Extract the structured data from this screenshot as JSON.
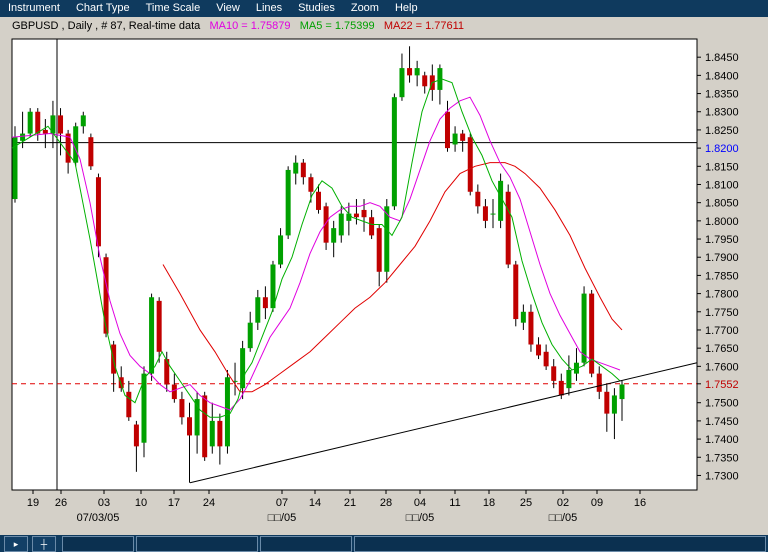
{
  "menu": [
    "Instrument",
    "Chart Type",
    "Time Scale",
    "View",
    "Lines",
    "Studies",
    "Zoom",
    "Help"
  ],
  "title": {
    "symbol": "GBPUSD , Daily , # 87, Real-time data",
    "ma10": "MA10 = 1.75879",
    "ma5": "MA5 = 1.75399",
    "ma22": "MA22 = 1.77611"
  },
  "colors": {
    "up": "#00a000",
    "down": "#c00000",
    "ma10": "#e000e0",
    "ma5": "#00b000",
    "ma22": "#e00000",
    "menu_bg": "#0f3a5e"
  },
  "status_icons": [
    "cursor-icon",
    "crosshair-icon"
  ],
  "chart_data": {
    "type": "candlestick",
    "y_ticks": [
      "1.8450",
      "1.8400",
      "1.8350",
      "1.8300",
      "1.8250",
      "1.8200",
      "1.8150",
      "1.8100",
      "1.8050",
      "1.8000",
      "1.7950",
      "1.7900",
      "1.7850",
      "1.7800",
      "1.7750",
      "1.7700",
      "1.7650",
      "1.7600",
      "1.7552",
      "1.7500",
      "1.7450",
      "1.7400",
      "1.7350",
      "1.7300"
    ],
    "highlight_ticks": {
      "1.8200": "#0000ff",
      "1.7552": "#c00000"
    },
    "ylim": [
      1.726,
      1.85
    ],
    "x_ticks": [
      "19",
      "26",
      "03",
      "10",
      "17",
      "24",
      "07",
      "14",
      "21",
      "28",
      "04",
      "11",
      "18",
      "25",
      "02",
      "09",
      "16"
    ],
    "x_date_labels": [
      "07/03/05",
      "□□/05",
      "□□/05",
      "□□/05"
    ],
    "horizontal_level": 1.8215,
    "current_price": 1.7552,
    "candles": [
      {
        "o": 1.806,
        "c": 1.823,
        "h": 1.826,
        "l": 1.805
      },
      {
        "o": 1.822,
        "c": 1.824,
        "h": 1.83,
        "l": 1.82
      },
      {
        "o": 1.824,
        "c": 1.83,
        "h": 1.831,
        "l": 1.823
      },
      {
        "o": 1.83,
        "c": 1.824,
        "h": 1.831,
        "l": 1.822
      },
      {
        "o": 1.825,
        "c": 1.824,
        "h": 1.828,
        "l": 1.82
      },
      {
        "o": 1.824,
        "c": 1.829,
        "h": 1.833,
        "l": 1.82
      },
      {
        "o": 1.829,
        "c": 1.824,
        "h": 1.831,
        "l": 1.818
      },
      {
        "o": 1.824,
        "c": 1.816,
        "h": 1.825,
        "l": 1.813
      },
      {
        "o": 1.816,
        "c": 1.826,
        "h": 1.827,
        "l": 1.815
      },
      {
        "o": 1.826,
        "c": 1.829,
        "h": 1.83,
        "l": 1.824
      },
      {
        "o": 1.823,
        "c": 1.815,
        "h": 1.824,
        "l": 1.814
      },
      {
        "o": 1.812,
        "c": 1.793,
        "h": 1.813,
        "l": 1.79
      },
      {
        "o": 1.79,
        "c": 1.769,
        "h": 1.791,
        "l": 1.768
      },
      {
        "o": 1.766,
        "c": 1.758,
        "h": 1.767,
        "l": 1.753
      },
      {
        "o": 1.757,
        "c": 1.754,
        "h": 1.76,
        "l": 1.753
      },
      {
        "o": 1.753,
        "c": 1.746,
        "h": 1.756,
        "l": 1.745
      },
      {
        "o": 1.744,
        "c": 1.738,
        "h": 1.745,
        "l": 1.731
      },
      {
        "o": 1.739,
        "c": 1.758,
        "h": 1.76,
        "l": 1.735
      },
      {
        "o": 1.758,
        "c": 1.779,
        "h": 1.78,
        "l": 1.756
      },
      {
        "o": 1.778,
        "c": 1.764,
        "h": 1.779,
        "l": 1.761
      },
      {
        "o": 1.762,
        "c": 1.755,
        "h": 1.764,
        "l": 1.753
      },
      {
        "o": 1.755,
        "c": 1.751,
        "h": 1.758,
        "l": 1.75
      },
      {
        "o": 1.751,
        "c": 1.746,
        "h": 1.753,
        "l": 1.744
      },
      {
        "o": 1.746,
        "c": 1.741,
        "h": 1.75,
        "l": 1.728
      },
      {
        "o": 1.741,
        "c": 1.751,
        "h": 1.753,
        "l": 1.736
      },
      {
        "o": 1.752,
        "c": 1.735,
        "h": 1.753,
        "l": 1.734
      },
      {
        "o": 1.738,
        "c": 1.745,
        "h": 1.75,
        "l": 1.736
      },
      {
        "o": 1.745,
        "c": 1.738,
        "h": 1.747,
        "l": 1.733
      },
      {
        "o": 1.738,
        "c": 1.757,
        "h": 1.759,
        "l": 1.736
      },
      {
        "o": 1.756,
        "c": 1.756,
        "h": 1.761,
        "l": 1.752
      },
      {
        "o": 1.754,
        "c": 1.765,
        "h": 1.767,
        "l": 1.751
      },
      {
        "o": 1.765,
        "c": 1.772,
        "h": 1.775,
        "l": 1.764
      },
      {
        "o": 1.772,
        "c": 1.779,
        "h": 1.781,
        "l": 1.77
      },
      {
        "o": 1.779,
        "c": 1.776,
        "h": 1.782,
        "l": 1.773
      },
      {
        "o": 1.776,
        "c": 1.788,
        "h": 1.789,
        "l": 1.775
      },
      {
        "o": 1.788,
        "c": 1.796,
        "h": 1.798,
        "l": 1.787
      },
      {
        "o": 1.796,
        "c": 1.814,
        "h": 1.815,
        "l": 1.795
      },
      {
        "o": 1.813,
        "c": 1.816,
        "h": 1.818,
        "l": 1.81
      },
      {
        "o": 1.816,
        "c": 1.812,
        "h": 1.817,
        "l": 1.81
      },
      {
        "o": 1.812,
        "c": 1.808,
        "h": 1.813,
        "l": 1.805
      },
      {
        "o": 1.808,
        "c": 1.803,
        "h": 1.81,
        "l": 1.802
      },
      {
        "o": 1.804,
        "c": 1.794,
        "h": 1.805,
        "l": 1.792
      },
      {
        "o": 1.794,
        "c": 1.798,
        "h": 1.8,
        "l": 1.79
      },
      {
        "o": 1.796,
        "c": 1.802,
        "h": 1.804,
        "l": 1.794
      },
      {
        "o": 1.8,
        "c": 1.802,
        "h": 1.805,
        "l": 1.796
      },
      {
        "o": 1.802,
        "c": 1.801,
        "h": 1.806,
        "l": 1.799
      },
      {
        "o": 1.803,
        "c": 1.801,
        "h": 1.806,
        "l": 1.797
      },
      {
        "o": 1.801,
        "c": 1.796,
        "h": 1.803,
        "l": 1.795
      },
      {
        "o": 1.798,
        "c": 1.786,
        "h": 1.799,
        "l": 1.782
      },
      {
        "o": 1.786,
        "c": 1.804,
        "h": 1.806,
        "l": 1.783
      },
      {
        "o": 1.804,
        "c": 1.834,
        "h": 1.835,
        "l": 1.803
      },
      {
        "o": 1.834,
        "c": 1.842,
        "h": 1.846,
        "l": 1.833
      },
      {
        "o": 1.842,
        "c": 1.84,
        "h": 1.848,
        "l": 1.838
      },
      {
        "o": 1.84,
        "c": 1.842,
        "h": 1.844,
        "l": 1.837
      },
      {
        "o": 1.84,
        "c": 1.837,
        "h": 1.841,
        "l": 1.835
      },
      {
        "o": 1.84,
        "c": 1.836,
        "h": 1.843,
        "l": 1.833
      },
      {
        "o": 1.836,
        "c": 1.842,
        "h": 1.843,
        "l": 1.832
      },
      {
        "o": 1.83,
        "c": 1.82,
        "h": 1.833,
        "l": 1.819
      },
      {
        "o": 1.821,
        "c": 1.824,
        "h": 1.826,
        "l": 1.819
      },
      {
        "o": 1.824,
        "c": 1.822,
        "h": 1.825,
        "l": 1.819
      },
      {
        "o": 1.823,
        "c": 1.808,
        "h": 1.824,
        "l": 1.807
      },
      {
        "o": 1.808,
        "c": 1.804,
        "h": 1.81,
        "l": 1.802
      },
      {
        "o": 1.804,
        "c": 1.8,
        "h": 1.806,
        "l": 1.798
      },
      {
        "o": 1.802,
        "c": 1.802,
        "h": 1.806,
        "l": 1.798
      },
      {
        "o": 1.8,
        "c": 1.811,
        "h": 1.813,
        "l": 1.798
      },
      {
        "o": 1.808,
        "c": 1.788,
        "h": 1.81,
        "l": 1.787
      },
      {
        "o": 1.788,
        "c": 1.773,
        "h": 1.789,
        "l": 1.771
      },
      {
        "o": 1.772,
        "c": 1.775,
        "h": 1.777,
        "l": 1.77
      },
      {
        "o": 1.775,
        "c": 1.766,
        "h": 1.777,
        "l": 1.764
      },
      {
        "o": 1.766,
        "c": 1.763,
        "h": 1.768,
        "l": 1.762
      },
      {
        "o": 1.764,
        "c": 1.76,
        "h": 1.766,
        "l": 1.759
      },
      {
        "o": 1.76,
        "c": 1.756,
        "h": 1.762,
        "l": 1.754
      },
      {
        "o": 1.756,
        "c": 1.752,
        "h": 1.758,
        "l": 1.751
      },
      {
        "o": 1.754,
        "c": 1.759,
        "h": 1.763,
        "l": 1.752
      },
      {
        "o": 1.758,
        "c": 1.761,
        "h": 1.765,
        "l": 1.756
      },
      {
        "o": 1.761,
        "c": 1.78,
        "h": 1.782,
        "l": 1.76
      },
      {
        "o": 1.78,
        "c": 1.758,
        "h": 1.781,
        "l": 1.757
      },
      {
        "o": 1.758,
        "c": 1.753,
        "h": 1.76,
        "l": 1.751
      },
      {
        "o": 1.753,
        "c": 1.747,
        "h": 1.755,
        "l": 1.742
      },
      {
        "o": 1.747,
        "c": 1.752,
        "h": 1.754,
        "l": 1.74
      },
      {
        "o": 1.751,
        "c": 1.755,
        "h": 1.756,
        "l": 1.745
      }
    ],
    "ma5_points": [
      [
        12,
        1.82
      ],
      [
        48,
        1.826
      ],
      [
        75,
        1.816
      ],
      [
        90,
        1.795
      ],
      [
        105,
        1.772
      ],
      [
        115,
        1.76
      ],
      [
        125,
        1.752
      ],
      [
        135,
        1.75
      ],
      [
        145,
        1.757
      ],
      [
        155,
        1.76
      ],
      [
        162,
        1.764
      ],
      [
        170,
        1.76
      ],
      [
        180,
        1.756
      ],
      [
        190,
        1.752
      ],
      [
        200,
        1.748
      ],
      [
        210,
        1.746
      ],
      [
        220,
        1.746
      ],
      [
        230,
        1.747
      ],
      [
        238,
        1.751
      ],
      [
        245,
        1.758
      ],
      [
        252,
        1.761
      ],
      [
        262,
        1.768
      ],
      [
        272,
        1.775
      ],
      [
        282,
        1.784
      ],
      [
        292,
        1.79
      ],
      [
        302,
        1.799
      ],
      [
        312,
        1.807
      ],
      [
        322,
        1.811
      ],
      [
        332,
        1.809
      ],
      [
        342,
        1.804
      ],
      [
        352,
        1.801
      ],
      [
        362,
        1.8
      ],
      [
        372,
        1.799
      ],
      [
        382,
        1.799
      ],
      [
        392,
        1.796
      ],
      [
        402,
        1.801
      ],
      [
        412,
        1.816
      ],
      [
        422,
        1.83
      ],
      [
        432,
        1.838
      ],
      [
        442,
        1.839
      ],
      [
        452,
        1.838
      ],
      [
        462,
        1.83
      ],
      [
        472,
        1.823
      ],
      [
        482,
        1.818
      ],
      [
        492,
        1.811
      ],
      [
        502,
        1.806
      ],
      [
        512,
        1.801
      ],
      [
        522,
        1.789
      ],
      [
        532,
        1.78
      ],
      [
        542,
        1.772
      ],
      [
        552,
        1.766
      ],
      [
        562,
        1.762
      ],
      [
        572,
        1.759
      ],
      [
        582,
        1.76
      ],
      [
        592,
        1.762
      ],
      [
        602,
        1.76
      ],
      [
        612,
        1.758
      ],
      [
        620,
        1.756
      ]
    ],
    "ma10_points": [
      [
        12,
        1.823
      ],
      [
        50,
        1.824
      ],
      [
        70,
        1.823
      ],
      [
        80,
        1.817
      ],
      [
        90,
        1.805
      ],
      [
        100,
        1.79
      ],
      [
        110,
        1.778
      ],
      [
        120,
        1.769
      ],
      [
        130,
        1.763
      ],
      [
        140,
        1.76
      ],
      [
        150,
        1.758
      ],
      [
        160,
        1.755
      ],
      [
        170,
        1.753
      ],
      [
        180,
        1.754
      ],
      [
        190,
        1.755
      ],
      [
        200,
        1.752
      ],
      [
        210,
        1.75
      ],
      [
        220,
        1.749
      ],
      [
        230,
        1.748
      ],
      [
        240,
        1.751
      ],
      [
        250,
        1.756
      ],
      [
        260,
        1.762
      ],
      [
        270,
        1.768
      ],
      [
        280,
        1.772
      ],
      [
        290,
        1.776
      ],
      [
        300,
        1.783
      ],
      [
        310,
        1.791
      ],
      [
        320,
        1.797
      ],
      [
        330,
        1.801
      ],
      [
        340,
        1.803
      ],
      [
        350,
        1.804
      ],
      [
        360,
        1.804
      ],
      [
        370,
        1.805
      ],
      [
        380,
        1.804
      ],
      [
        390,
        1.801
      ],
      [
        400,
        1.8
      ],
      [
        410,
        1.806
      ],
      [
        420,
        1.814
      ],
      [
        430,
        1.822
      ],
      [
        440,
        1.828
      ],
      [
        450,
        1.831
      ],
      [
        460,
        1.833
      ],
      [
        470,
        1.834
      ],
      [
        480,
        1.829
      ],
      [
        490,
        1.822
      ],
      [
        500,
        1.816
      ],
      [
        510,
        1.812
      ],
      [
        520,
        1.806
      ],
      [
        530,
        1.797
      ],
      [
        540,
        1.788
      ],
      [
        550,
        1.78
      ],
      [
        560,
        1.774
      ],
      [
        570,
        1.769
      ],
      [
        580,
        1.764
      ],
      [
        590,
        1.762
      ],
      [
        600,
        1.761
      ],
      [
        610,
        1.76
      ],
      [
        620,
        1.759
      ]
    ],
    "ma22_points": [
      [
        163,
        1.788
      ],
      [
        180,
        1.78
      ],
      [
        200,
        1.77
      ],
      [
        215,
        1.764
      ],
      [
        228,
        1.758
      ],
      [
        240,
        1.753
      ],
      [
        252,
        1.753
      ],
      [
        265,
        1.755
      ],
      [
        280,
        1.758
      ],
      [
        295,
        1.761
      ],
      [
        310,
        1.764
      ],
      [
        325,
        1.768
      ],
      [
        340,
        1.772
      ],
      [
        355,
        1.776
      ],
      [
        370,
        1.779
      ],
      [
        385,
        1.783
      ],
      [
        400,
        1.788
      ],
      [
        415,
        1.793
      ],
      [
        430,
        1.8
      ],
      [
        445,
        1.808
      ],
      [
        460,
        1.813
      ],
      [
        475,
        1.815
      ],
      [
        490,
        1.816
      ],
      [
        505,
        1.816
      ],
      [
        515,
        1.815
      ],
      [
        525,
        1.813
      ],
      [
        540,
        1.809
      ],
      [
        555,
        1.803
      ],
      [
        570,
        1.796
      ],
      [
        585,
        1.787
      ],
      [
        600,
        1.779
      ],
      [
        612,
        1.773
      ],
      [
        622,
        1.77
      ]
    ],
    "trendline": [
      [
        190,
        1.728
      ],
      [
        697,
        1.761
      ]
    ]
  }
}
